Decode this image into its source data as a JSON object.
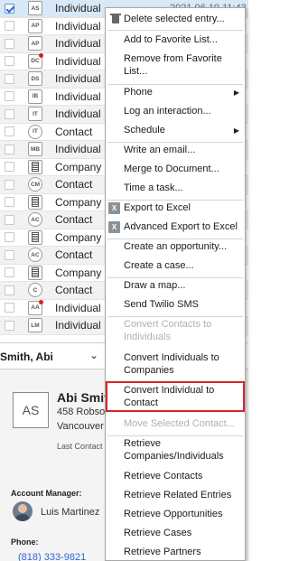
{
  "list": {
    "rows": [
      {
        "icon": "AS",
        "shape": "square",
        "type": "Individual",
        "date": "2021 06 10 11:43",
        "checked": true,
        "style": "sel"
      },
      {
        "icon": "AP",
        "shape": "square",
        "type": "Individual",
        "checked": false,
        "style": ""
      },
      {
        "icon": "AP",
        "shape": "square",
        "type": "Individual",
        "checked": false,
        "style": "alt"
      },
      {
        "icon": "DC",
        "shape": "square",
        "dot": true,
        "type": "Individual",
        "checked": false,
        "style": ""
      },
      {
        "icon": "DS",
        "shape": "square",
        "type": "Individual",
        "checked": false,
        "style": "alt"
      },
      {
        "icon": "IB",
        "shape": "square",
        "type": "Individual",
        "checked": false,
        "style": ""
      },
      {
        "icon": "IT",
        "shape": "square",
        "type": "Individual",
        "checked": false,
        "style": "alt"
      },
      {
        "icon": "IT",
        "shape": "circle",
        "type": "Contact",
        "checked": false,
        "style": ""
      },
      {
        "icon": "MB",
        "shape": "square",
        "type": "Individual",
        "checked": false,
        "style": "alt"
      },
      {
        "icon": "",
        "shape": "building",
        "type": "Company",
        "checked": false,
        "style": ""
      },
      {
        "icon": "CM",
        "shape": "circle",
        "type": "Contact",
        "checked": false,
        "style": "alt"
      },
      {
        "icon": "",
        "shape": "building",
        "type": "Company",
        "checked": false,
        "style": ""
      },
      {
        "icon": "AC",
        "shape": "circle",
        "type": "Contact",
        "checked": false,
        "style": "alt"
      },
      {
        "icon": "",
        "shape": "building",
        "type": "Company",
        "checked": false,
        "style": ""
      },
      {
        "icon": "AC",
        "shape": "circle",
        "type": "Contact",
        "checked": false,
        "style": "alt"
      },
      {
        "icon": "",
        "shape": "building",
        "type": "Company",
        "checked": false,
        "style": ""
      },
      {
        "icon": "C",
        "shape": "circle",
        "type": "Contact",
        "checked": false,
        "style": "alt"
      },
      {
        "icon": "AA",
        "shape": "square",
        "dot": true,
        "type": "Individual",
        "checked": false,
        "style": ""
      },
      {
        "icon": "LM",
        "shape": "square",
        "type": "Individual",
        "checked": false,
        "style": "alt"
      }
    ]
  },
  "detail": {
    "dropdown_name": "Smith, Abi",
    "avatar_initials": "AS",
    "name": "Abi Smith",
    "address_line1": "458 Robso",
    "address_line2": "Vancouver",
    "last_contact_label": "Last Contact",
    "account_manager_label": "Account Manager:",
    "account_manager": "Luis Martinez",
    "phone_label": "Phone:",
    "phone": "(818) 333-9821"
  },
  "menu": {
    "items": [
      {
        "label": "Delete selected entry...",
        "icon": "trash-icon"
      },
      {
        "sep": true
      },
      {
        "label": "Add to Favorite List..."
      },
      {
        "label": "Remove from Favorite List..."
      },
      {
        "sep": true
      },
      {
        "label": "Phone",
        "submenu": true
      },
      {
        "label": "Log an interaction..."
      },
      {
        "label": "Schedule",
        "submenu": true
      },
      {
        "sep": true
      },
      {
        "label": "Write an email..."
      },
      {
        "label": "Merge to Document..."
      },
      {
        "label": "Time a task..."
      },
      {
        "sep": true
      },
      {
        "label": "Export to Excel",
        "icon": "excel-icon"
      },
      {
        "label": "Advanced Export to Excel",
        "icon": "excel-advanced-icon"
      },
      {
        "sep": true
      },
      {
        "label": "Create an opportunity..."
      },
      {
        "label": "Create a case..."
      },
      {
        "sep": true
      },
      {
        "label": "Draw a map..."
      },
      {
        "label": "Send Twilio SMS"
      },
      {
        "sep": true
      },
      {
        "label": "Convert Contacts to Individuals",
        "disabled": true
      },
      {
        "label": "Convert Individuals to Companies"
      },
      {
        "label": "Convert Individual to Contact",
        "highlighted": true
      },
      {
        "label": "Move Selected Contact...",
        "disabled": true
      },
      {
        "sep": true
      },
      {
        "label": "Retrieve Companies/Individuals"
      },
      {
        "label": "Retrieve Contacts"
      },
      {
        "label": "Retrieve Related Entries"
      },
      {
        "label": "Retrieve Opportunities"
      },
      {
        "label": "Retrieve Cases"
      },
      {
        "label": "Retrieve Partners"
      }
    ],
    "highlight_color": "#d8242a"
  }
}
